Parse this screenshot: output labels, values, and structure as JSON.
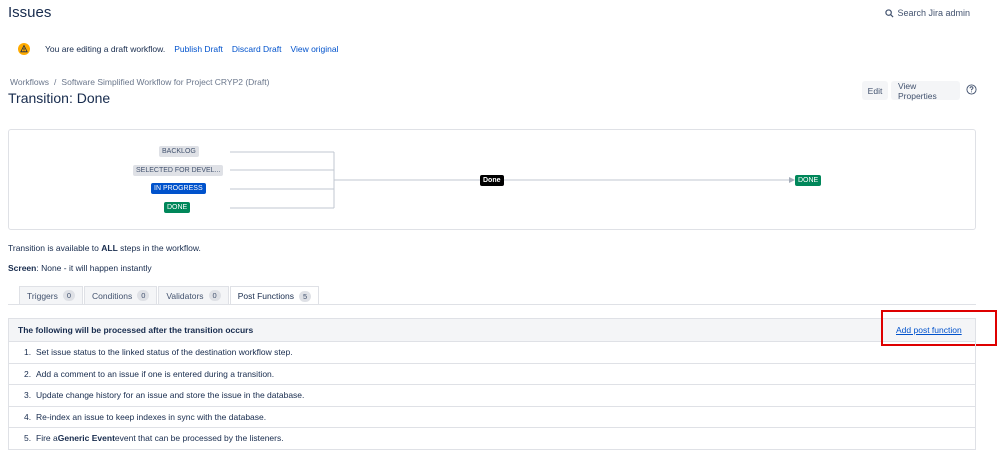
{
  "header": {
    "title": "Issues",
    "search_label": "Search Jira admin"
  },
  "draft_banner": {
    "message": "You are editing a draft workflow.",
    "publish": "Publish Draft",
    "discard": "Discard Draft",
    "view_original": "View original"
  },
  "breadcrumb": {
    "root": "Workflows",
    "sep": "/",
    "current": "Software Simplified Workflow for Project CRYP2 (Draft)"
  },
  "transition_title": "Transition: Done",
  "actions": {
    "edit": "Edit",
    "view_properties": "View Properties"
  },
  "diagram": {
    "from_statuses": [
      "BACKLOG",
      "SELECTED FOR DEVEL...",
      "IN PROGRESS",
      "DONE"
    ],
    "transition": "Done",
    "to_status": "DONE",
    "colors": {
      "grey": "#dfe1e6",
      "blue": "#0052cc",
      "green": "#00875a",
      "black": "#000000"
    }
  },
  "info": {
    "available_prefix": "Transition is available to ",
    "available_bold": "ALL",
    "available_suffix": " steps in the workflow.",
    "screen_label": "Screen",
    "screen_value": ": None - it will happen instantly"
  },
  "tabs": [
    {
      "label": "Triggers",
      "count": "0"
    },
    {
      "label": "Conditions",
      "count": "0"
    },
    {
      "label": "Validators",
      "count": "0"
    },
    {
      "label": "Post Functions",
      "count": "5"
    }
  ],
  "post_functions": {
    "header": "The following will be processed after the transition occurs",
    "add_label": "Add post function",
    "items": [
      {
        "num": "1.",
        "text": "Set issue status to the linked status of the destination workflow step."
      },
      {
        "num": "2.",
        "text": "Add a comment to an issue if one is entered during a transition."
      },
      {
        "num": "3.",
        "text": "Update change history for an issue and store the issue in the database."
      },
      {
        "num": "4.",
        "text": "Re-index an issue to keep indexes in sync with the database."
      },
      {
        "num": "5.",
        "pre": "Fire a ",
        "bold": "Generic Event",
        "post": " event that can be processed by the listeners."
      }
    ]
  },
  "highlight_color": "#de0000"
}
